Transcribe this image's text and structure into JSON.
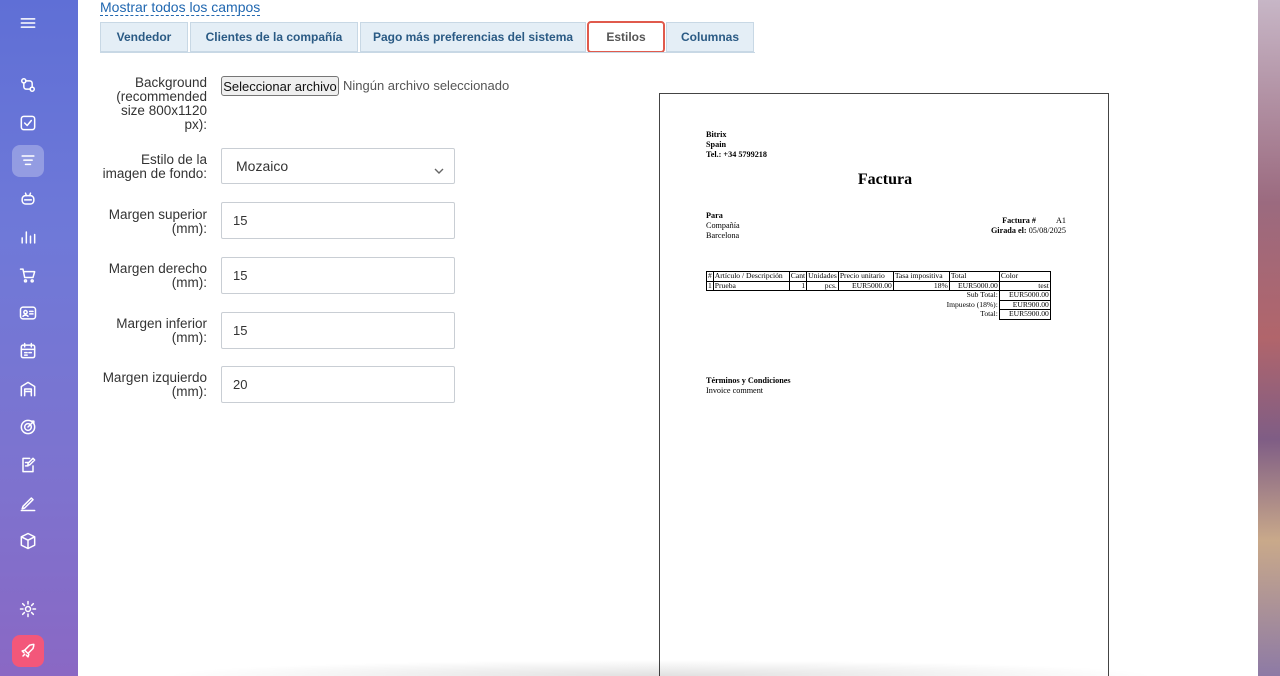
{
  "top_link": "Mostrar todos los campos",
  "tabs": [
    {
      "label": "Vendedor"
    },
    {
      "label": "Clientes de la compañía"
    },
    {
      "label": "Pago más preferencias del sistema"
    },
    {
      "label": "Estilos",
      "active": true
    },
    {
      "label": "Columnas"
    }
  ],
  "form": {
    "background_label": "Background (recommended size 800x1120 px):",
    "file_button": "Seleccionar archivo",
    "file_status": "Ningún archivo seleccionado",
    "bg_style_label": "Estilo de la imagen de fondo:",
    "bg_style_value": "Mozaico",
    "margin_top_label": "Margen superior (mm):",
    "margin_top_value": "15",
    "margin_right_label": "Margen derecho (mm):",
    "margin_right_value": "15",
    "margin_bottom_label": "Margen inferior (mm):",
    "margin_bottom_value": "15",
    "margin_left_label": "Margen izquierdo (mm):",
    "margin_left_value": "20"
  },
  "invoice": {
    "company": "Bitrix",
    "country": "Spain",
    "phone": "Tel.: +34 5799218",
    "title": "Factura",
    "to_label": "Para",
    "to_company": "Compañía",
    "to_city": "Barcelona",
    "invoice_no_label": "Factura #",
    "invoice_no": "A1",
    "issued_label": "Girada el:",
    "issued_date": "05/08/2025",
    "columns": [
      "#",
      "Artículo / Descripción",
      "Cant",
      "Unidades",
      "Precio unitario",
      "Tasa impositiva",
      "Total",
      "Color"
    ],
    "row": [
      "1",
      "Prueba",
      "1",
      "pcs.",
      "EUR5000.00",
      "18%",
      "EUR5000.00",
      "test"
    ],
    "subtotal_label": "Sub Total:",
    "subtotal_value": "EUR5000.00",
    "tax_label": "Impuesto (18%):",
    "tax_value": "EUR900.00",
    "total_label": "Total:",
    "total_value": "EUR5900.00",
    "terms_title": "Términos y Condiciones",
    "terms_text": "Invoice comment"
  },
  "sidebar_icons": [
    "menu-icon",
    "automation-icon",
    "tasks-icon",
    "crm-icon",
    "robot-icon",
    "analytics-icon",
    "shop-icon",
    "contact-card-icon",
    "calendar-icon",
    "warehouse-icon",
    "target-icon",
    "document-edit-icon",
    "sign-icon",
    "package-icon",
    "settings-icon",
    "rocket-icon"
  ],
  "colors": {
    "accent": "#2067b0",
    "highlight": "#e05a4c",
    "sidebar": "#6f79d8"
  }
}
